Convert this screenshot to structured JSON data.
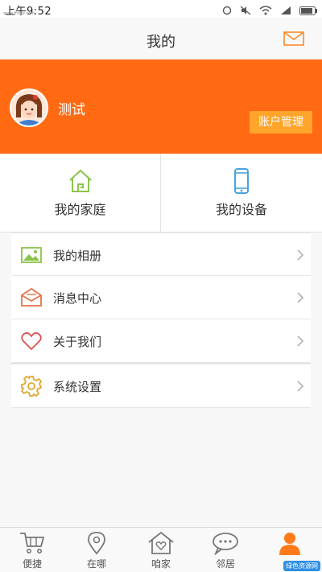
{
  "status_bar": {
    "time": "上午9:52",
    "watermark": "www.ffxiaz.com"
  },
  "header": {
    "title": "我的",
    "mail_icon": "mail-icon"
  },
  "profile": {
    "username": "测试",
    "account_button": "账户管理",
    "avatar_icon": "girl-avatar"
  },
  "quick": [
    {
      "label": "我的家庭",
      "icon": "home-icon"
    },
    {
      "label": "我的设备",
      "icon": "phone-icon"
    }
  ],
  "menu": [
    {
      "label": "我的相册",
      "icon": "album-icon"
    },
    {
      "label": "消息中心",
      "icon": "message-icon"
    },
    {
      "label": "关于我们",
      "icon": "heart-icon"
    },
    {
      "label": "系统设置",
      "icon": "gear-icon"
    }
  ],
  "tabs": [
    {
      "label": "便捷",
      "icon": "cart-icon"
    },
    {
      "label": "在哪",
      "icon": "location-icon"
    },
    {
      "label": "咱家",
      "icon": "home-heart-icon"
    },
    {
      "label": "邻居",
      "icon": "chat-icon"
    },
    {
      "label": "",
      "icon": "person-icon",
      "active": true
    }
  ],
  "colors": {
    "accent": "#ff6a13",
    "account_button": "#ffa52b",
    "quick_green": "#8bc34a",
    "quick_blue": "#4aa3df"
  },
  "badge": "绿色资源网"
}
